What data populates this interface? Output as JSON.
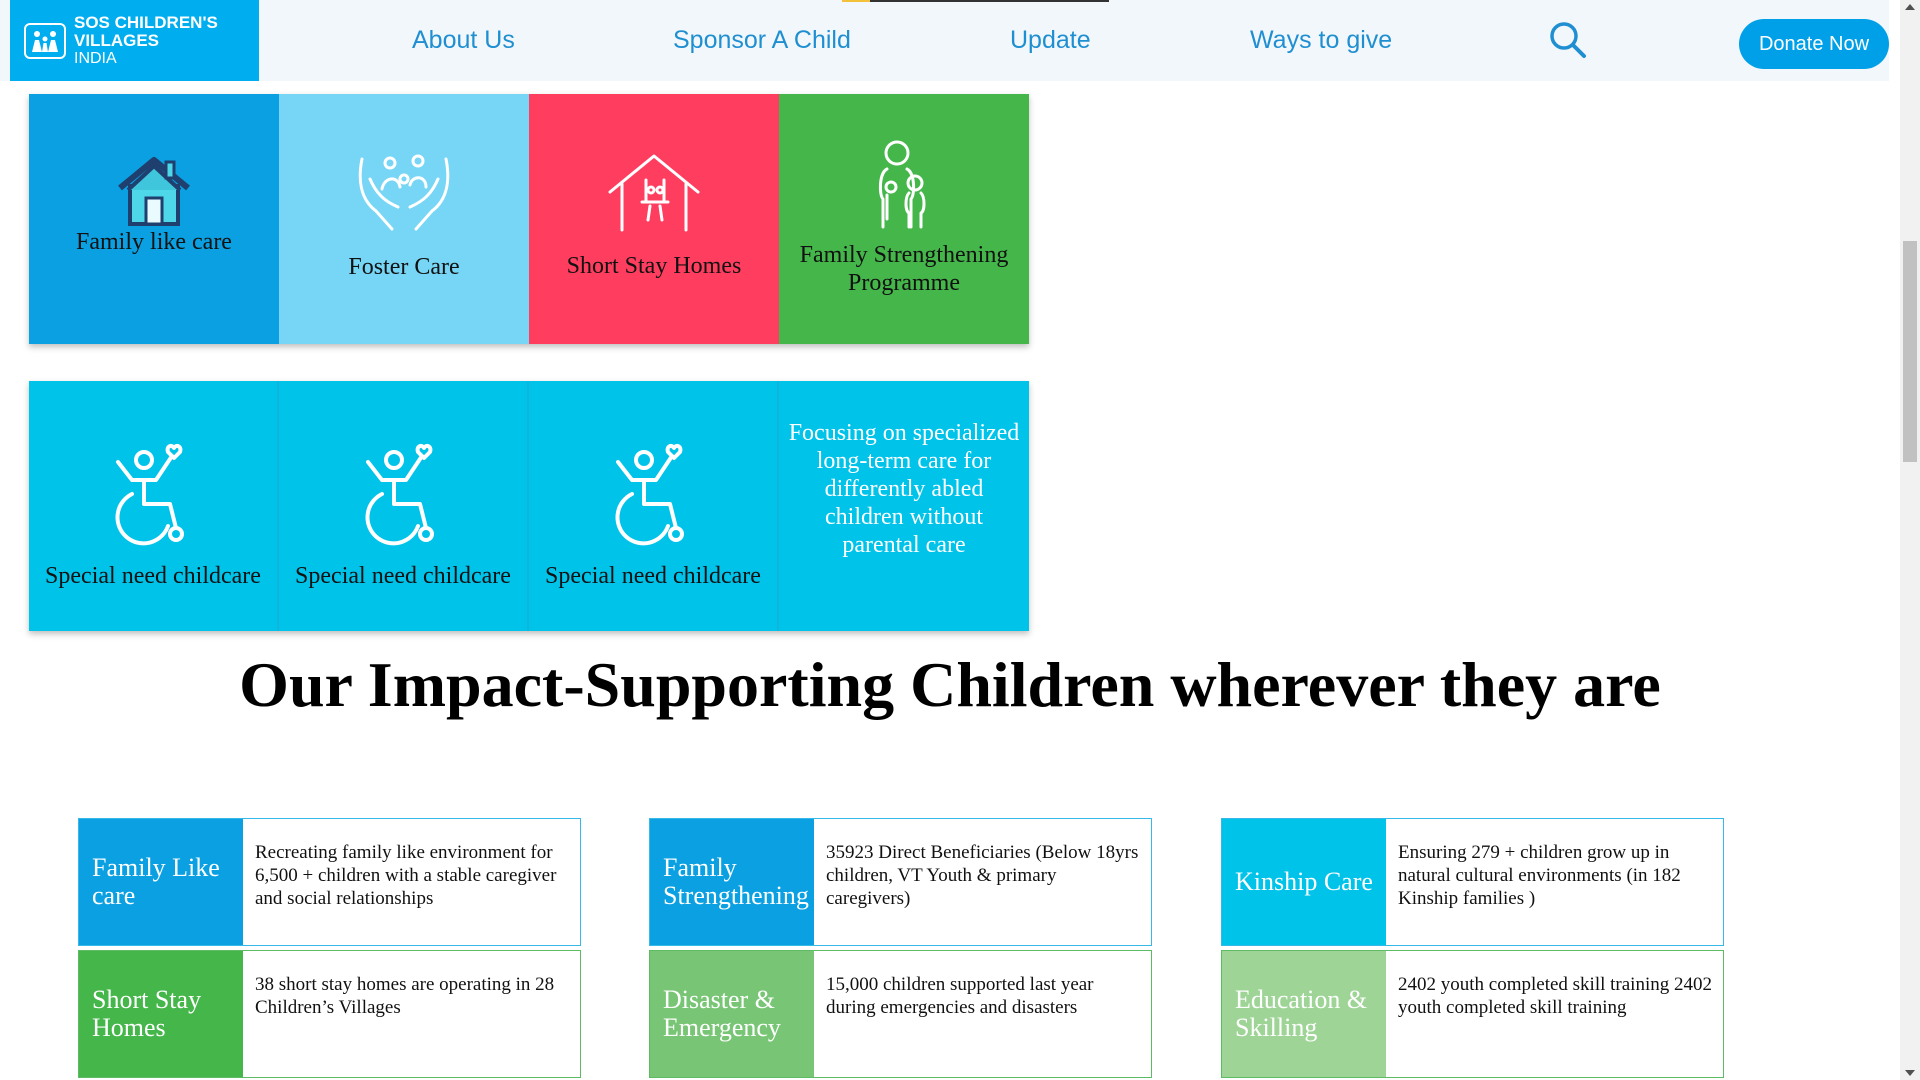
{
  "header": {
    "logo": {
      "line1": "SOS CHILDREN'S",
      "line2": "VILLAGES",
      "line3": "INDIA"
    },
    "nav": [
      {
        "label": "About Us"
      },
      {
        "label": "Sponsor A Child"
      },
      {
        "label": "Update"
      },
      {
        "label": "Ways to give"
      }
    ],
    "donate_label": "Donate Now"
  },
  "tiles_row1": [
    {
      "label": "Family like care",
      "color": "#0aa0e2",
      "icon": "house-icon"
    },
    {
      "label": "Foster Care",
      "color": "#77d6f5",
      "icon": "caring-hands-icon"
    },
    {
      "label": "Short Stay Homes",
      "color": "#ff3d5f",
      "icon": "home-swing-icon"
    },
    {
      "label": "Family Strengthening Programme",
      "color": "#44b64a",
      "icon": "family-icon"
    }
  ],
  "tiles_row2": [
    {
      "label": "Special need childcare",
      "icon": "wheelchair-icon"
    },
    {
      "label": "Special need childcare",
      "icon": "wheelchair-icon"
    },
    {
      "label": "Special need childcare",
      "icon": "wheelchair-icon"
    },
    {
      "text": "Focusing on specialized long-term care for differently abled children without parental care"
    }
  ],
  "impact": {
    "heading": "Our Impact-Supporting Children wherever they are",
    "cards": [
      {
        "title": "Family Like care",
        "text": "Recreating family like environment for 6,500 + children with a stable caregiver and social relationships",
        "color": "#0aa0e2"
      },
      {
        "title": "Family Strengthening",
        "text": "35923 Direct Beneficiaries (Below 18yrs children, VT Youth & primary caregivers)",
        "color": "#0aa0e2"
      },
      {
        "title": "Kinship Care",
        "text": "Ensuring 279 + children grow up in natural cultural environments (in 182 Kinship families )",
        "color": "#00c3ea"
      },
      {
        "title": "Short Stay Homes",
        "text": "38 short stay homes are operating in 28 Children’s Villages",
        "color": "#44b64a"
      },
      {
        "title": "Disaster & Emergency",
        "text": "15,000 children supported last year during emergencies and disasters",
        "color": "#78c675"
      },
      {
        "title": "Education & Skilling",
        "text": "2402 youth completed skill training 2402 youth completed skill training",
        "color": "#9ed596"
      }
    ]
  }
}
